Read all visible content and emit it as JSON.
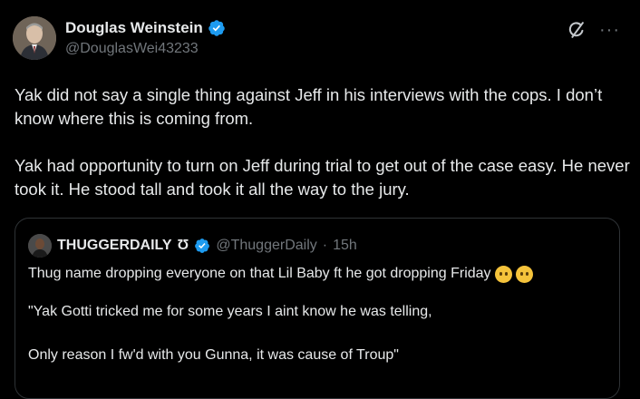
{
  "author": {
    "display_name": "Douglas Weinstein",
    "handle": "@DouglasWei43233",
    "avatar_icon": "profile-photo",
    "verified_icon": "verified-badge-icon"
  },
  "actions": {
    "grok_icon": "grok-icon",
    "more_icon": "more-options-icon"
  },
  "tweet": {
    "paragraph_1": "Yak did not say a single thing against Jeff in his interviews with the cops. I don’t know where this is coming from.",
    "paragraph_2": "Yak had opportunity to turn on Jeff during trial to get out of the case easy. He never took it. He stood tall and took it all the way to the jury."
  },
  "quote": {
    "display_name": "THUGGERDAILY",
    "name_symbol": "Ʊ",
    "handle": "@ThuggerDaily",
    "separator": "·",
    "time": "15h",
    "line_1": "Thug name dropping everyone on that Lil Baby ft he got dropping Friday",
    "line_2": "\"Yak Gotti tricked me for some years I aint know he was telling,",
    "line_3": "Only reason I fw'd with you Gunna, it was cause of Troup\""
  },
  "colors": {
    "background": "#000000",
    "text": "#e7e9ea",
    "secondary": "#71767b",
    "verified": "#1d9bf0",
    "border": "#2f3336"
  }
}
